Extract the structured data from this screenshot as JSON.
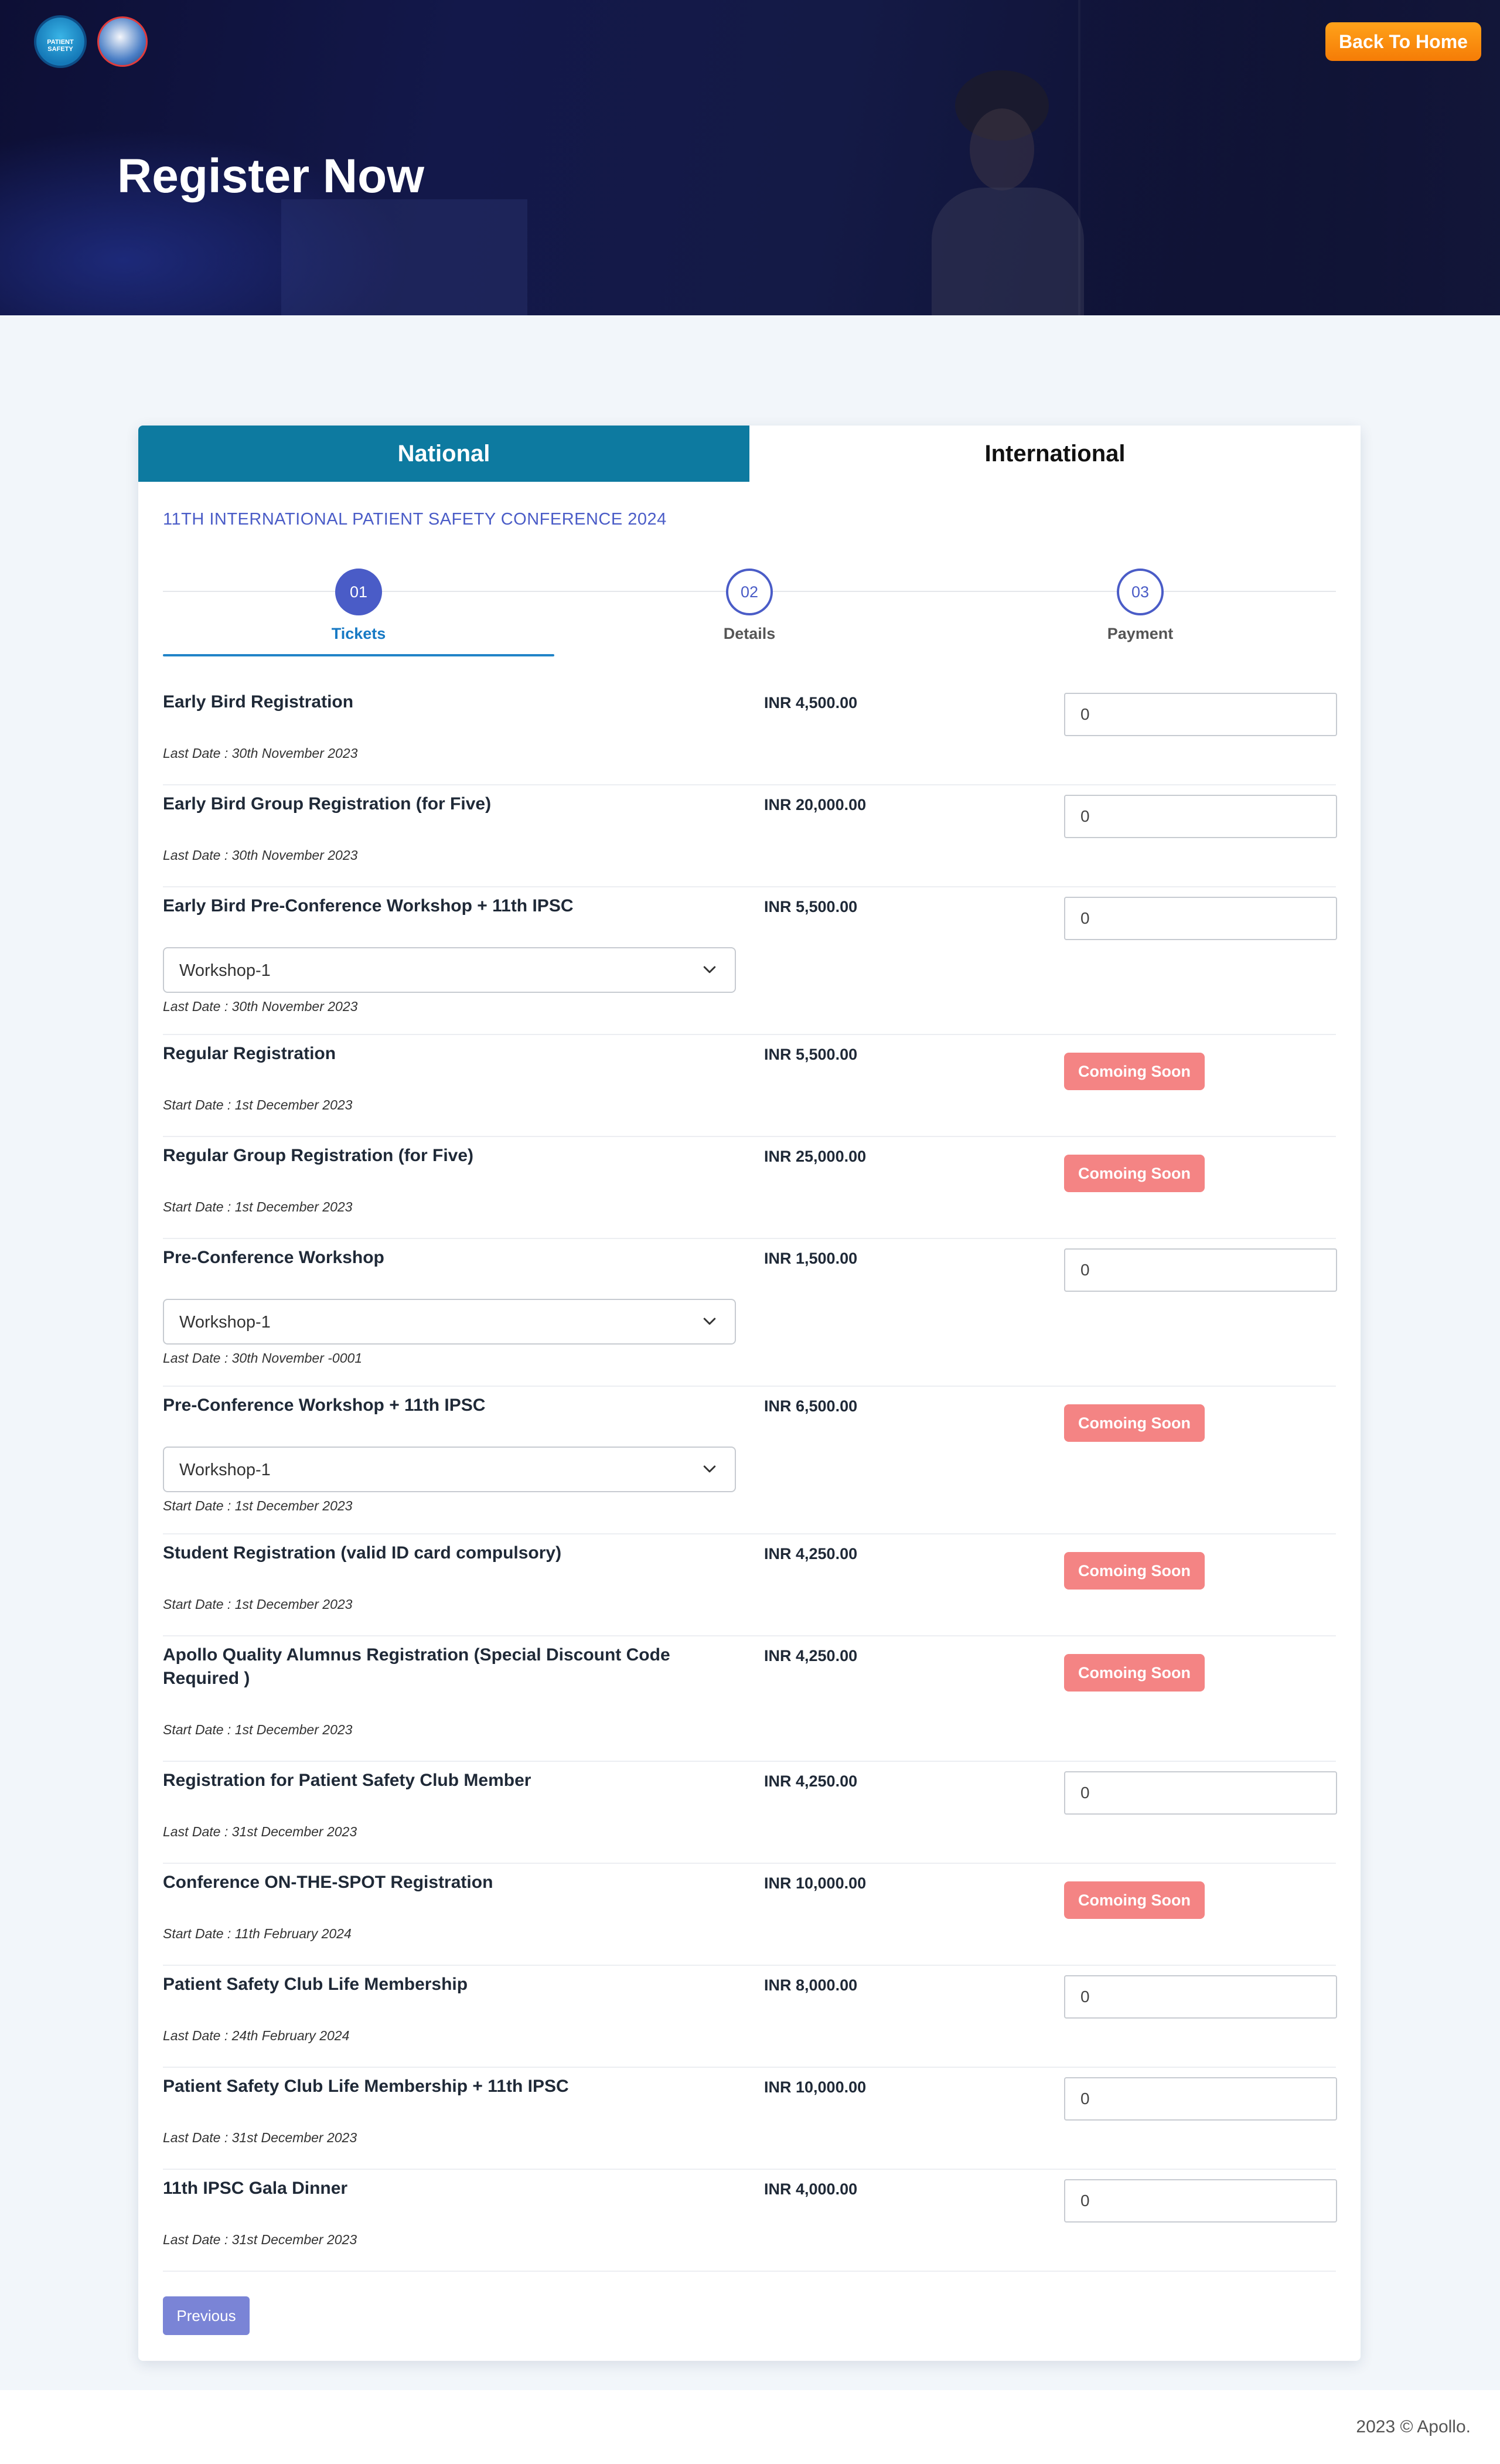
{
  "header": {
    "back_label": "Back To Home",
    "title": "Register Now",
    "logo1_text": "PATIENT SAFETY"
  },
  "tabs": [
    {
      "label": "National",
      "active": true
    },
    {
      "label": "International",
      "active": false
    }
  ],
  "conference_title": "11TH INTERNATIONAL PATIENT SAFETY CONFERENCE 2024",
  "steps": [
    {
      "number": "01",
      "label": "Tickets",
      "active": true
    },
    {
      "number": "02",
      "label": "Details",
      "active": false
    },
    {
      "number": "03",
      "label": "Payment",
      "active": false
    }
  ],
  "tickets": [
    {
      "name": "Early Bird Registration",
      "price": "INR 4,500.00",
      "date": "Last Date : 30th November 2023",
      "action": "input",
      "qty": "0"
    },
    {
      "name": "Early Bird Group Registration (for Five)",
      "price": "INR 20,000.00",
      "date": "Last Date : 30th November 2023",
      "action": "input",
      "qty": "0"
    },
    {
      "name": "Early Bird Pre-Conference Workshop + 11th IPSC",
      "price": "INR 5,500.00",
      "date": "Last Date : 30th November 2023",
      "action": "input",
      "qty": "0",
      "select": "Workshop-1"
    },
    {
      "name": "Regular Registration",
      "price": "INR 5,500.00",
      "date": "Start Date : 1st December 2023",
      "action": "soon",
      "soon": "Comoing Soon"
    },
    {
      "name": "Regular Group Registration (for Five)",
      "price": "INR 25,000.00",
      "date": "Start Date : 1st December 2023",
      "action": "soon",
      "soon": "Comoing Soon"
    },
    {
      "name": "Pre-Conference Workshop",
      "price": "INR 1,500.00",
      "date": "Last Date : 30th November -0001",
      "action": "input",
      "qty": "0",
      "select": "Workshop-1"
    },
    {
      "name": "Pre-Conference Workshop + 11th IPSC",
      "price": "INR 6,500.00",
      "date": "Start Date : 1st December 2023",
      "action": "soon",
      "soon": "Comoing Soon",
      "select": "Workshop-1"
    },
    {
      "name": "Student Registration (valid ID card compulsory)",
      "price": "INR 4,250.00",
      "date": "Start Date : 1st December 2023",
      "action": "soon",
      "soon": "Comoing Soon"
    },
    {
      "name": "Apollo Quality Alumnus Registration (Special Discount Code Required )",
      "price": "INR 4,250.00",
      "date": "Start Date : 1st December 2023",
      "action": "soon",
      "soon": "Comoing Soon"
    },
    {
      "name": "Registration for Patient Safety Club Member",
      "price": "INR 4,250.00",
      "date": "Last Date : 31st December 2023",
      "action": "input",
      "qty": "0"
    },
    {
      "name": "Conference ON-THE-SPOT Registration",
      "price": "INR 10,000.00",
      "date": "Start Date : 11th February 2024",
      "action": "soon",
      "soon": "Comoing Soon"
    },
    {
      "name": "Patient Safety Club Life Membership",
      "price": "INR 8,000.00",
      "date": "Last Date : 24th February 2024",
      "action": "input",
      "qty": "0"
    },
    {
      "name": "Patient Safety Club Life Membership + 11th IPSC",
      "price": "INR 10,000.00",
      "date": "Last Date : 31st December 2023",
      "action": "input",
      "qty": "0"
    },
    {
      "name": "11th IPSC Gala Dinner",
      "price": "INR 4,000.00",
      "date": "Last Date : 31st December 2023",
      "action": "input",
      "qty": "0"
    }
  ],
  "previous_label": "Previous",
  "footer": "2023 © Apollo."
}
